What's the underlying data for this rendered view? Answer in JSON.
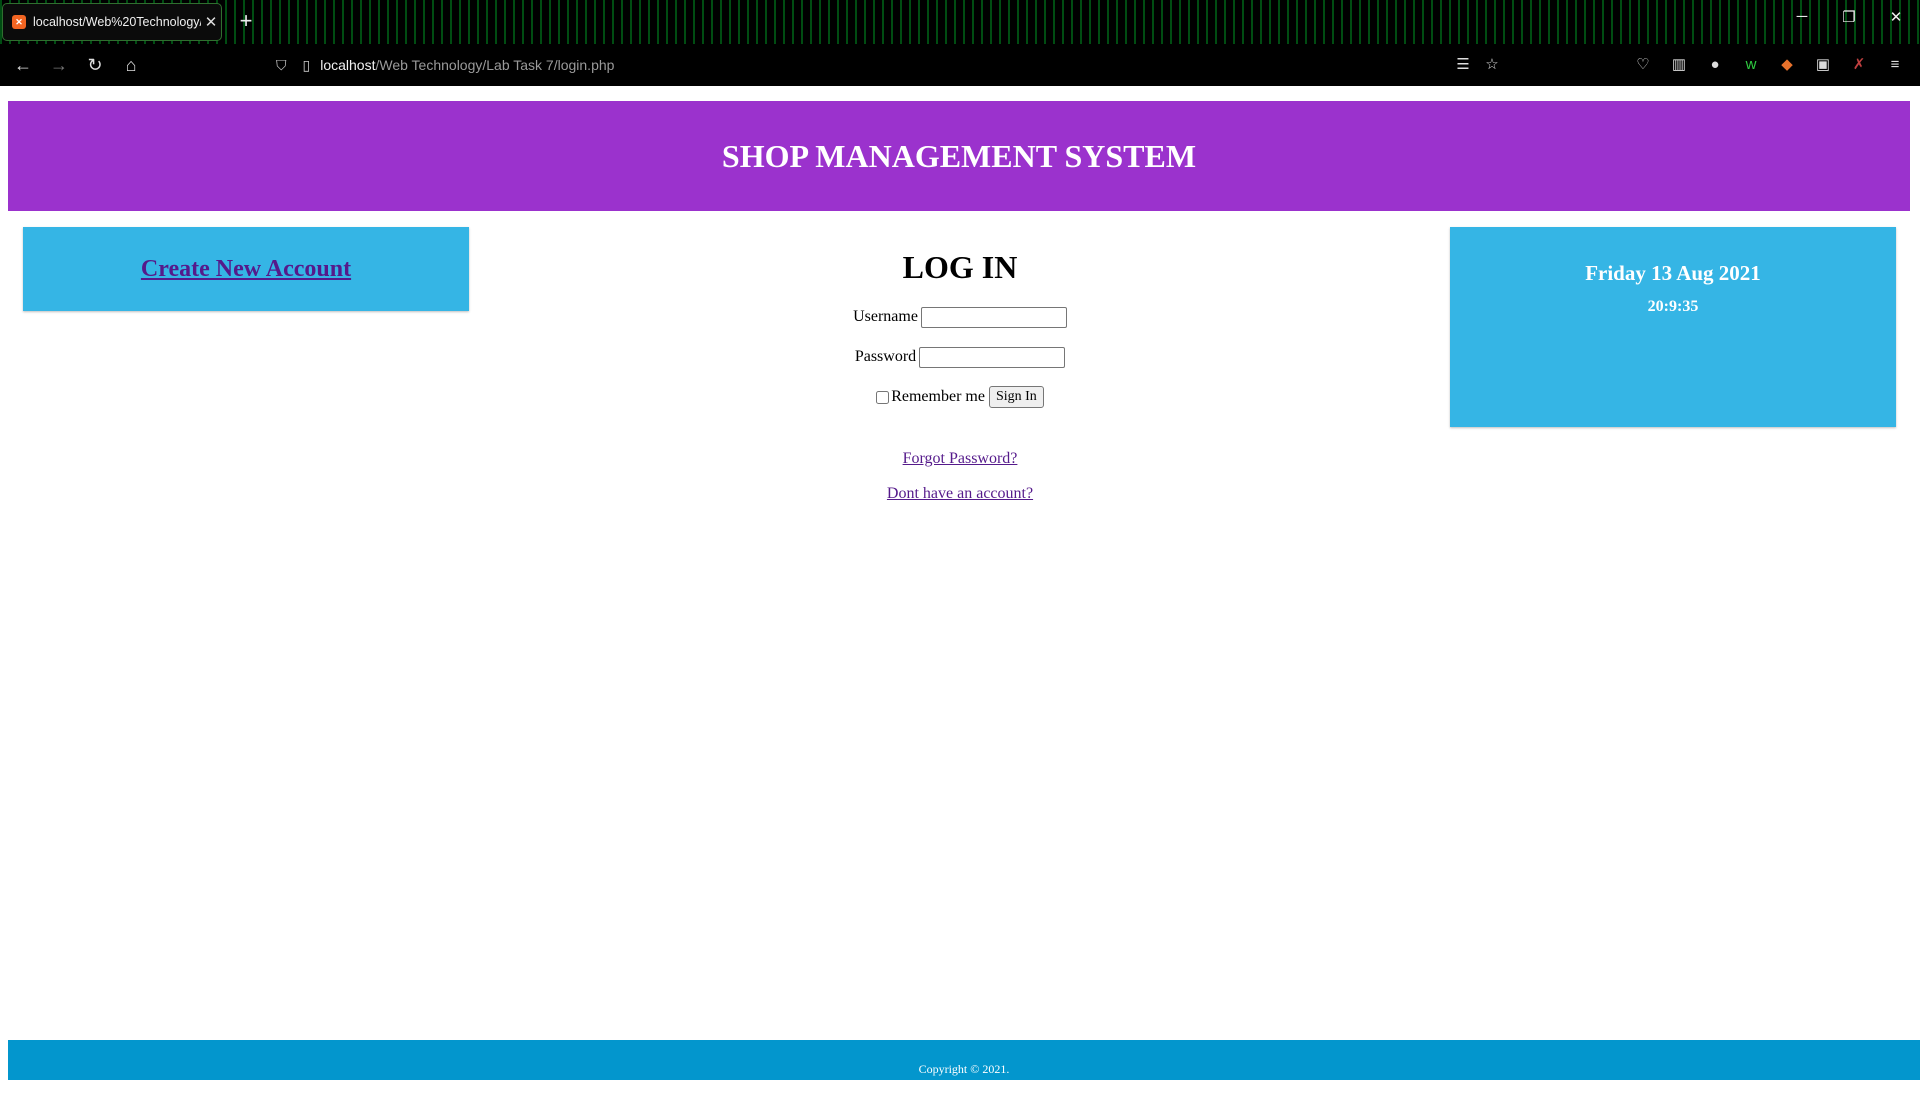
{
  "browser": {
    "tab_title": "localhost/Web%20Technology/L",
    "tab_close": "✕",
    "new_tab": "+",
    "url_host": "localhost",
    "url_path": "/Web Technology/Lab Task 7/login.php"
  },
  "page": {
    "header_title": "SHOP MANAGEMENT SYSTEM",
    "create_account": "Create New Account",
    "login_heading": "LOG IN",
    "username_label": "Username",
    "username_value": "",
    "password_label": "Password",
    "password_value": "",
    "remember_label": "Remember me",
    "signin_label": "Sign In",
    "forgot_link": "Forgot Password?",
    "signup_link": "Dont have an account?",
    "date": "Friday 13 Aug 2021",
    "time": "20:9:35",
    "footer": "Copyright © 2021."
  },
  "colors": {
    "header": "#9b32cd",
    "side_box": "#35b5e5",
    "footer": "#0396cd",
    "link": "#551a8b"
  }
}
